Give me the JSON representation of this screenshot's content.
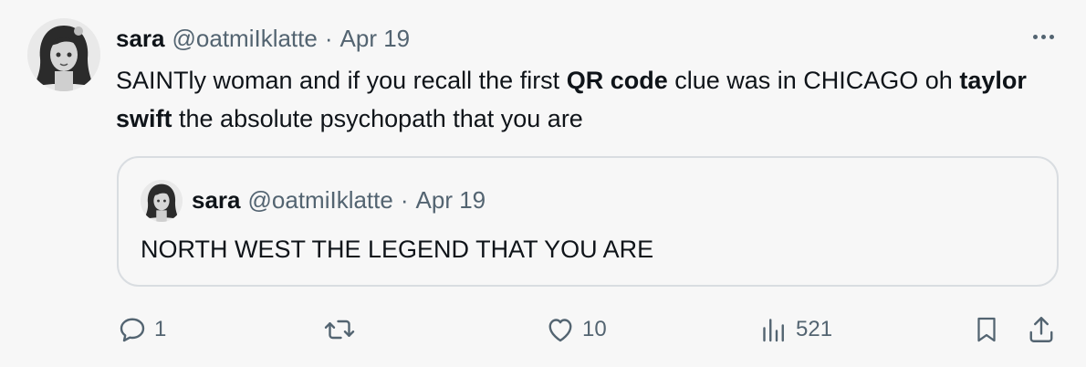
{
  "tweet": {
    "author_name": "sara",
    "handle": "@oatmiIklatte",
    "separator": "·",
    "date": "Apr 19",
    "text": {
      "part1": "SAINTly woman and if you recall the first ",
      "bold1": "QR code",
      "part2": " clue was in CHICAGO oh ",
      "bold2": "taylor swift",
      "part3": " the absolute psychopath that you are"
    }
  },
  "quoted_tweet": {
    "author_name": "sara",
    "handle": "@oatmiIklatte",
    "separator": "·",
    "date": "Apr 19",
    "text": "NORTH WEST THE LEGEND THAT YOU ARE"
  },
  "actions": {
    "reply_count": "1",
    "retweet_count": "",
    "like_count": "10",
    "view_count": "521"
  },
  "icons": {
    "more": "more-horizontal-icon",
    "reply": "speech-bubble-icon",
    "retweet": "retweet-icon",
    "like": "heart-icon",
    "views": "bar-chart-icon",
    "bookmark": "bookmark-icon",
    "share": "share-upload-icon"
  },
  "colors": {
    "background": "#f7f7f7",
    "primary_text": "#0f1419",
    "secondary_text": "#536471",
    "border": "#d9dde1"
  }
}
